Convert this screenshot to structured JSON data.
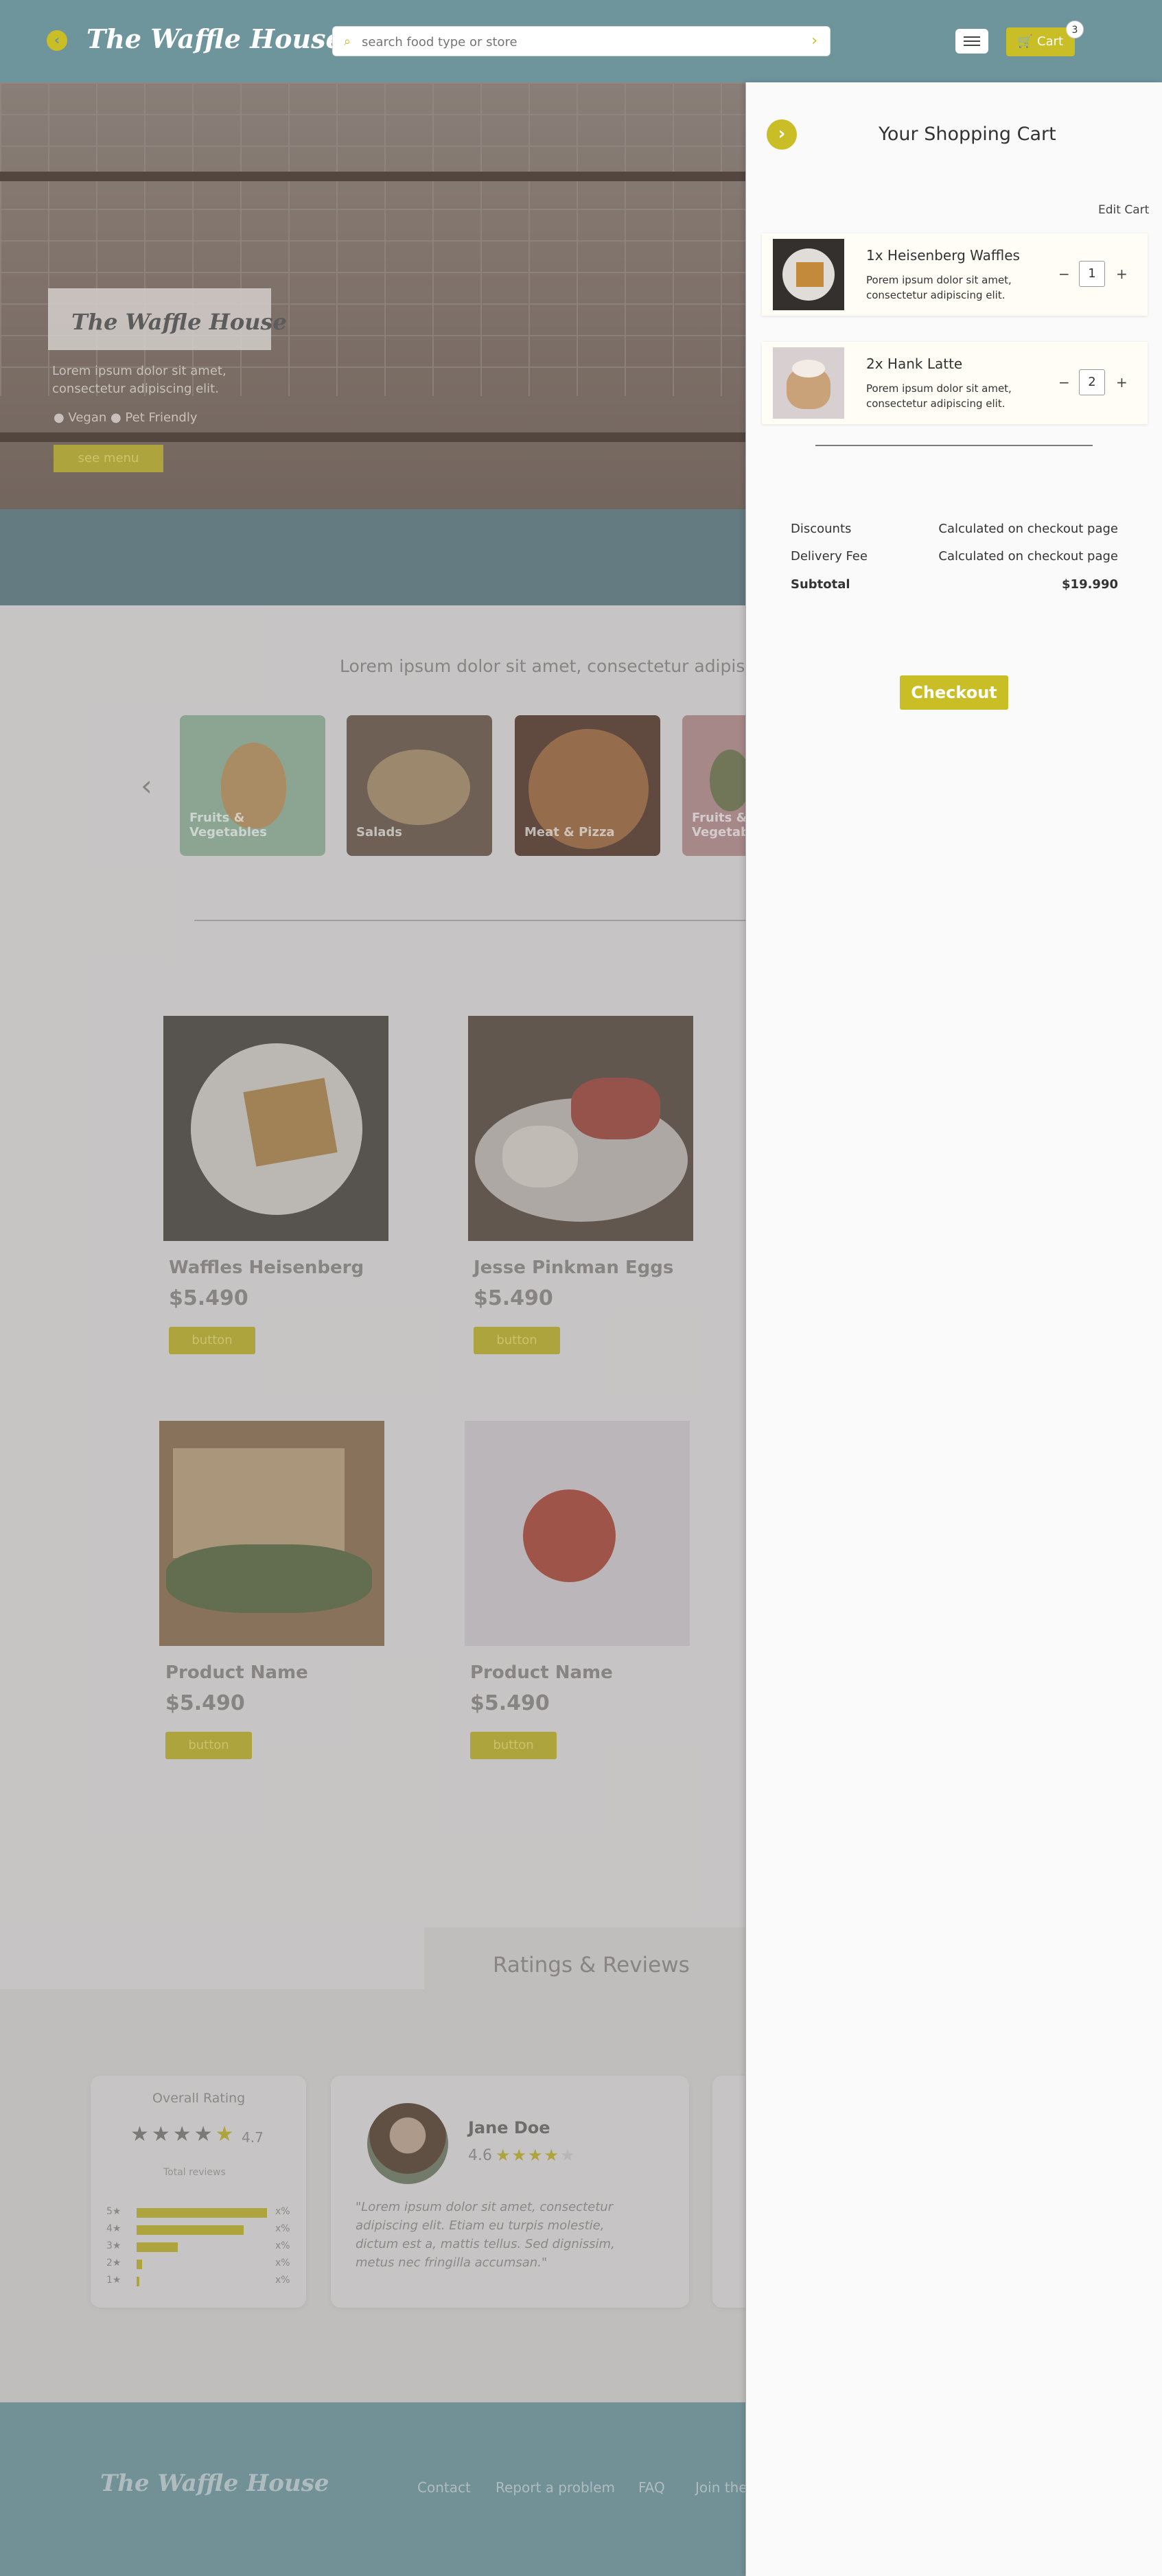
{
  "header": {
    "logo": "The Waffle House",
    "search_placeholder": "search food type or store",
    "cart_label": "Cart",
    "cart_count": "3"
  },
  "hero": {
    "title": "The Waffle House",
    "text": "Lorem ipsum dolor sit amet, consectetur adipiscing elit.",
    "tags": "● Vegan  ● Pet Friendly",
    "button": "see menu"
  },
  "tagline": "Lorem ipsum dolor sit amet, consectetur adipis",
  "categories": [
    {
      "label": "Fruits & Vegetables"
    },
    {
      "label": "Salads"
    },
    {
      "label": "Meat & Pizza"
    },
    {
      "label": "Fruits & Vegetables"
    }
  ],
  "products": [
    {
      "name": "Waffles Heisenberg",
      "price": "$5.490",
      "button": "button"
    },
    {
      "name": "Jesse Pinkman Eggs",
      "price": "$5.490",
      "button": "button"
    },
    {
      "name": "Product Name",
      "price": "$5.490",
      "button": "button"
    },
    {
      "name": "Product Name",
      "price": "$5.490",
      "button": "button"
    }
  ],
  "reviews": {
    "title": "Ratings & Reviews",
    "overall_label": "Overall Rating",
    "overall_score": "4.7",
    "total_reviews": "Total reviews",
    "bars": [
      {
        "label": "5★",
        "pct": "x%",
        "fill": 0.95
      },
      {
        "label": "4★",
        "pct": "x%",
        "fill": 0.78
      },
      {
        "label": "3★",
        "pct": "x%",
        "fill": 0.3
      },
      {
        "label": "2★",
        "pct": "x%",
        "fill": 0.04
      },
      {
        "label": "1★",
        "pct": "x%",
        "fill": 0.02
      }
    ],
    "reviewer_name": "Jane Doe",
    "reviewer_score": "4.6",
    "reviewer_text": "\"Lorem ipsum dolor sit amet, consectetur adipiscing elit. Etiam eu turpis molestie, dictum est a, mattis tellus. Sed dignissim, metus nec fringilla accumsan.\""
  },
  "footer": {
    "logo": "The Waffle House",
    "links": [
      "Contact",
      "Report a problem",
      "FAQ",
      "Join the"
    ]
  },
  "cart": {
    "title": "Your Shopping Cart",
    "edit": "Edit Cart",
    "items": [
      {
        "title": "1x Heisenberg Waffles",
        "desc": "Porem ipsum dolor sit amet, consectetur adipiscing elit.",
        "qty": "1"
      },
      {
        "title": "2x Hank Latte",
        "desc": "Porem ipsum dolor sit amet, consectetur adipiscing elit.",
        "qty": "2"
      }
    ],
    "summary": {
      "discounts_label": "Discounts",
      "discounts_value": "Calculated on checkout page",
      "delivery_label": "Delivery Fee",
      "delivery_value": "Calculated on checkout page",
      "subtotal_label": "Subtotal",
      "subtotal_value": "$19.990"
    },
    "checkout": "Checkout"
  },
  "colors": {
    "accent": "#c9be26",
    "header": "#6f959c",
    "drawer": "#fafafa"
  }
}
